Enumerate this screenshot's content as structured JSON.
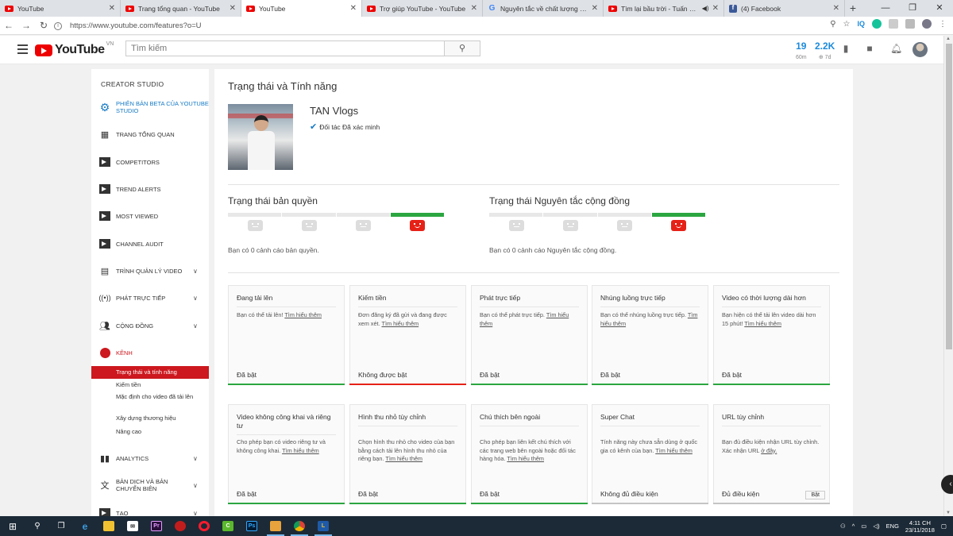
{
  "browser": {
    "tabs": [
      {
        "label": "YouTube",
        "favicon": "youtube-icon",
        "active": false
      },
      {
        "label": "Trang tổng quan - YouTube",
        "favicon": "youtube-icon",
        "active": false
      },
      {
        "label": "YouTube",
        "favicon": "youtube-icon",
        "active": true
      },
      {
        "label": "Trợ giúp YouTube - YouTube",
        "favicon": "youtube-icon",
        "active": false
      },
      {
        "label": "Nguyên tắc về chất lượng dành c",
        "favicon": "google-icon",
        "active": false
      },
      {
        "label": "Tìm lại bầu trời - Tuấn Hưng",
        "favicon": "youtube-icon",
        "active": false
      },
      {
        "label": "(4) Facebook",
        "favicon": "facebook-icon",
        "active": false
      }
    ],
    "url": "https://www.youtube.com/features?o=U",
    "ext_iq": "IQ"
  },
  "header": {
    "logo_text": "YouTube",
    "logo_region": "VN",
    "search_placeholder": "Tìm kiếm",
    "stat1": {
      "value": "19",
      "label": "60m"
    },
    "stat2": {
      "value": "2.2K",
      "label": "⊕ 7d"
    }
  },
  "sidebar": {
    "title": "CREATOR STUDIO",
    "items": [
      {
        "label": "PHIÊN BẢN BETA CỦA YOUTUBE STUDIO",
        "icon": "gear-icon"
      },
      {
        "label": "TRANG TỔNG QUAN",
        "icon": "dashboard-icon"
      },
      {
        "label": "COMPETITORS",
        "icon": "plugin-icon"
      },
      {
        "label": "TREND ALERTS",
        "icon": "plugin-icon"
      },
      {
        "label": "MOST VIEWED",
        "icon": "plugin-icon"
      },
      {
        "label": "CHANNEL AUDIT",
        "icon": "plugin-icon"
      },
      {
        "label": "TRÌNH QUẢN LÝ VIDEO",
        "icon": "video-manager-icon"
      },
      {
        "label": "PHÁT TRỰC TIẾP",
        "icon": "live-icon"
      },
      {
        "label": "CỘNG ĐỒNG",
        "icon": "community-icon"
      },
      {
        "label": "KÊNH",
        "icon": "channel-icon"
      }
    ],
    "channel_sub": [
      "Trạng thái và tính năng",
      "Kiếm tiền",
      "Mặc định cho video đã tải lên",
      "Xây dựng thương hiệu",
      "Nâng cao"
    ],
    "bottom_items": [
      {
        "label": "ANALYTICS",
        "icon": "analytics-icon"
      },
      {
        "label": "BẢN DỊCH VÀ BẢN CHUYỂN BIÊN",
        "icon": "translate-icon"
      },
      {
        "label": "TẠO",
        "icon": "create-icon"
      }
    ]
  },
  "main": {
    "title": "Trạng thái và Tính năng",
    "channel_name": "TAN Vlogs",
    "verified_text": "Đối tác Đã xác minh",
    "copyright": {
      "title": "Trạng thái bản quyền",
      "text": "Bạn có 0 cảnh cáo bản quyền.",
      "active_level": 4
    },
    "community": {
      "title": "Trạng thái Nguyên tắc cộng đồng",
      "text": "Bạn có 0 cảnh cáo Nguyên tắc cộng đồng.",
      "active_level": 4
    },
    "learn_more": "Tìm hiểu thêm",
    "cards": [
      {
        "title": "Đang tải lên",
        "desc": "Bạn có thể tải lên!",
        "link": "Tìm hiểu thêm",
        "status": "Đã bật",
        "bar": "green"
      },
      {
        "title": "Kiếm tiền",
        "desc": "Đơn đăng ký đã gửi và đang được xem xét.",
        "link": "Tìm hiểu thêm",
        "status": "Không được bật",
        "bar": "red"
      },
      {
        "title": "Phát trực tiếp",
        "desc": "Bạn có thể phát trực tiếp.",
        "link": "Tìm hiểu thêm",
        "status": "Đã bật",
        "bar": "green"
      },
      {
        "title": "Nhúng luồng trực tiếp",
        "desc": "Bạn có thể nhúng luồng trực tiếp.",
        "link": "Tìm hiểu thêm",
        "status": "Đã bật",
        "bar": "green"
      },
      {
        "title": "Video có thời lượng dài hơn",
        "desc": "Bạn hiện có thể tải lên video dài hơn 15 phút!",
        "link": "Tìm hiểu thêm",
        "status": "Đã bật",
        "bar": "green"
      },
      {
        "title": "Video không công khai và riêng tư",
        "desc": "Cho phép bạn có video riêng tư và không công khai.",
        "link": "Tìm hiểu thêm",
        "status": "Đã bật",
        "bar": "green"
      },
      {
        "title": "Hình thu nhỏ tùy chỉnh",
        "desc": "Chọn hình thu nhỏ cho video của bạn bằng cách tải lên hình thu nhỏ của riêng bạn.",
        "link": "Tìm hiểu thêm",
        "status": "Đã bật",
        "bar": "green"
      },
      {
        "title": "Chú thích bên ngoài",
        "desc": "Cho phép bạn liên kết chú thích với các trang web bên ngoài hoặc đối tác hàng hóa.",
        "link": "Tìm hiểu thêm",
        "status": "Đã bật",
        "bar": "green"
      },
      {
        "title": "Super Chat",
        "desc": "Tính năng này chưa sẵn dùng ở quốc gia có kênh của bạn.",
        "link": "Tìm hiểu thêm",
        "status": "Không đủ điều kiện",
        "bar": "gray"
      },
      {
        "title": "URL tùy chỉnh",
        "desc": "Bạn đủ điều kiện nhận URL tùy chỉnh. Xác nhận URL",
        "link": "ở đây.",
        "status": "Đủ điều kiện",
        "bar": "gray",
        "button": "Bật"
      }
    ]
  },
  "taskbar": {
    "lang": "ENG",
    "time": "4:11 CH",
    "date": "23/11/2018"
  },
  "colors": {
    "brand_red": "#e62117",
    "link_blue": "#167ac6",
    "status_green": "#2ba640"
  }
}
